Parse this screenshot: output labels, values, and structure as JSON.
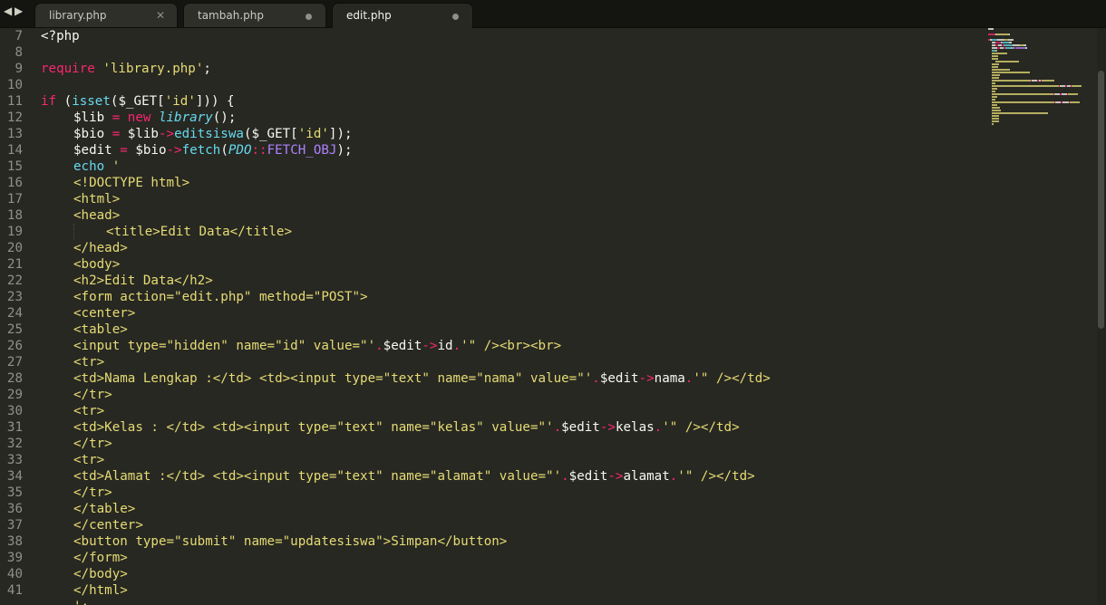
{
  "tabs": [
    {
      "label": "library.php",
      "icon": "close-icon",
      "glyph": "✕"
    },
    {
      "label": "tambah.php",
      "icon": "unsaved-dot-icon",
      "glyph": ""
    },
    {
      "label": "edit.php",
      "icon": "unsaved-dot-icon",
      "glyph": "",
      "active": true
    }
  ],
  "nav": {
    "back": "◀",
    "forward": "▶"
  },
  "colors": {
    "background": "#272822",
    "keyword": "#f92672",
    "string": "#e6db74",
    "function": "#66d9ef",
    "constant": "#ae81ff",
    "text": "#f8f8f2",
    "gutter": "#90908a"
  },
  "editor": {
    "lines": [
      {
        "n": "7",
        "tokens": [
          {
            "t": "<?php",
            "c": "var"
          }
        ]
      },
      {
        "n": "8",
        "tokens": []
      },
      {
        "n": "9",
        "tokens": [
          {
            "t": "require",
            "c": "kw"
          },
          {
            "t": " ",
            "c": "var"
          },
          {
            "t": "'library.php'",
            "c": "str"
          },
          {
            "t": ";",
            "c": "var"
          }
        ]
      },
      {
        "n": "10",
        "tokens": []
      },
      {
        "n": "11",
        "tokens": [
          {
            "t": "if",
            "c": "kw"
          },
          {
            "t": " (",
            "c": "var"
          },
          {
            "t": "isset",
            "c": "fn"
          },
          {
            "t": "($_GET[",
            "c": "var"
          },
          {
            "t": "'id'",
            "c": "str"
          },
          {
            "t": "])) {",
            "c": "var"
          }
        ]
      },
      {
        "n": "12",
        "indent": 1,
        "tokens": [
          {
            "t": "$lib",
            "c": "var"
          },
          {
            "t": " = ",
            "c": "op"
          },
          {
            "t": "new",
            "c": "kw"
          },
          {
            "t": " ",
            "c": "var"
          },
          {
            "t": "library",
            "c": "cls"
          },
          {
            "t": "();",
            "c": "var"
          }
        ]
      },
      {
        "n": "13",
        "indent": 1,
        "tokens": [
          {
            "t": "$bio",
            "c": "var"
          },
          {
            "t": " = ",
            "c": "op"
          },
          {
            "t": "$lib",
            "c": "var"
          },
          {
            "t": "->",
            "c": "op"
          },
          {
            "t": "editsiswa",
            "c": "fn"
          },
          {
            "t": "($_GET[",
            "c": "var"
          },
          {
            "t": "'id'",
            "c": "str"
          },
          {
            "t": "]);",
            "c": "var"
          }
        ]
      },
      {
        "n": "14",
        "indent": 1,
        "tokens": [
          {
            "t": "$edit",
            "c": "var"
          },
          {
            "t": " = ",
            "c": "op"
          },
          {
            "t": "$bio",
            "c": "var"
          },
          {
            "t": "->",
            "c": "op"
          },
          {
            "t": "fetch",
            "c": "fn"
          },
          {
            "t": "(",
            "c": "var"
          },
          {
            "t": "PDO",
            "c": "cls"
          },
          {
            "t": "::",
            "c": "op"
          },
          {
            "t": "FETCH_OBJ",
            "c": "const"
          },
          {
            "t": ");",
            "c": "var"
          }
        ]
      },
      {
        "n": "15",
        "indent": 1,
        "tokens": [
          {
            "t": "echo",
            "c": "fn"
          },
          {
            "t": " '",
            "c": "str"
          }
        ]
      },
      {
        "n": "16",
        "indent": 1,
        "tokens": [
          {
            "t": "<!DOCTYPE html>",
            "c": "str"
          }
        ]
      },
      {
        "n": "17",
        "indent": 1,
        "tokens": [
          {
            "t": "<html>",
            "c": "str"
          }
        ]
      },
      {
        "n": "18",
        "indent": 1,
        "tokens": [
          {
            "t": "<head>",
            "c": "str"
          }
        ]
      },
      {
        "n": "19",
        "indent": 2,
        "tokens": [
          {
            "t": "<title>Edit Data</title>",
            "c": "str"
          }
        ]
      },
      {
        "n": "20",
        "indent": 1,
        "tokens": [
          {
            "t": "</head>",
            "c": "str"
          }
        ]
      },
      {
        "n": "21",
        "indent": 1,
        "tokens": [
          {
            "t": "<body>",
            "c": "str"
          }
        ]
      },
      {
        "n": "22",
        "indent": 1,
        "tokens": [
          {
            "t": "<h2>Edit Data</h2>",
            "c": "str"
          }
        ]
      },
      {
        "n": "23",
        "indent": 1,
        "tokens": [
          {
            "t": "<form action=\"edit.php\" method=\"POST\">",
            "c": "str"
          }
        ]
      },
      {
        "n": "24",
        "indent": 1,
        "tokens": [
          {
            "t": "<center>",
            "c": "str"
          }
        ]
      },
      {
        "n": "25",
        "indent": 1,
        "tokens": [
          {
            "t": "<table>",
            "c": "str"
          }
        ]
      },
      {
        "n": "26",
        "indent": 1,
        "tokens": [
          {
            "t": "<input type=\"hidden\" name=\"id\" value=\"'",
            "c": "str"
          },
          {
            "t": ".",
            "c": "op"
          },
          {
            "t": "$edit",
            "c": "var"
          },
          {
            "t": "->",
            "c": "op"
          },
          {
            "t": "id",
            "c": "prop"
          },
          {
            "t": ".",
            "c": "op"
          },
          {
            "t": "'\" /><br><br>",
            "c": "str"
          }
        ]
      },
      {
        "n": "27",
        "indent": 1,
        "tokens": [
          {
            "t": "<tr>",
            "c": "str"
          }
        ]
      },
      {
        "n": "28",
        "indent": 1,
        "tokens": [
          {
            "t": "<td>Nama Lengkap :</td> <td><input type=\"text\" name=\"nama\" value=\"'",
            "c": "str"
          },
          {
            "t": ".",
            "c": "op"
          },
          {
            "t": "$edit",
            "c": "var"
          },
          {
            "t": "->",
            "c": "op"
          },
          {
            "t": "nama",
            "c": "prop"
          },
          {
            "t": ".",
            "c": "op"
          },
          {
            "t": "'\" /></td>",
            "c": "str"
          }
        ]
      },
      {
        "n": "29",
        "indent": 1,
        "tokens": [
          {
            "t": "</tr>",
            "c": "str"
          }
        ]
      },
      {
        "n": "30",
        "indent": 1,
        "tokens": [
          {
            "t": "<tr>",
            "c": "str"
          }
        ]
      },
      {
        "n": "31",
        "indent": 1,
        "tokens": [
          {
            "t": "<td>Kelas : </td> <td><input type=\"text\" name=\"kelas\" value=\"'",
            "c": "str"
          },
          {
            "t": ".",
            "c": "op"
          },
          {
            "t": "$edit",
            "c": "var"
          },
          {
            "t": "->",
            "c": "op"
          },
          {
            "t": "kelas",
            "c": "prop"
          },
          {
            "t": ".",
            "c": "op"
          },
          {
            "t": "'\" /></td>",
            "c": "str"
          }
        ]
      },
      {
        "n": "32",
        "indent": 1,
        "tokens": [
          {
            "t": "</tr>",
            "c": "str"
          }
        ]
      },
      {
        "n": "33",
        "indent": 1,
        "tokens": [
          {
            "t": "<tr>",
            "c": "str"
          }
        ]
      },
      {
        "n": "34",
        "indent": 1,
        "tokens": [
          {
            "t": "<td>Alamat :</td> <td><input type=\"text\" name=\"alamat\" value=\"'",
            "c": "str"
          },
          {
            "t": ".",
            "c": "op"
          },
          {
            "t": "$edit",
            "c": "var"
          },
          {
            "t": "->",
            "c": "op"
          },
          {
            "t": "alamat",
            "c": "prop"
          },
          {
            "t": ".",
            "c": "op"
          },
          {
            "t": "'\" /></td>",
            "c": "str"
          }
        ]
      },
      {
        "n": "35",
        "indent": 1,
        "tokens": [
          {
            "t": "</tr>",
            "c": "str"
          }
        ]
      },
      {
        "n": "36",
        "indent": 1,
        "tokens": [
          {
            "t": "</table>",
            "c": "str"
          }
        ]
      },
      {
        "n": "37",
        "indent": 1,
        "tokens": [
          {
            "t": "</center>",
            "c": "str"
          }
        ]
      },
      {
        "n": "38",
        "indent": 1,
        "tokens": [
          {
            "t": "<button type=\"submit\" name=\"updatesiswa\">Simpan</button>",
            "c": "str"
          }
        ]
      },
      {
        "n": "39",
        "indent": 1,
        "tokens": [
          {
            "t": "</form>",
            "c": "str"
          }
        ]
      },
      {
        "n": "40",
        "indent": 1,
        "tokens": [
          {
            "t": "</body>",
            "c": "str"
          }
        ]
      },
      {
        "n": "41",
        "indent": 1,
        "tokens": [
          {
            "t": "</html>",
            "c": "str"
          }
        ]
      },
      {
        "n": "",
        "indent": 1,
        "tokens": [
          {
            "t": "';",
            "c": "str"
          }
        ]
      }
    ]
  }
}
